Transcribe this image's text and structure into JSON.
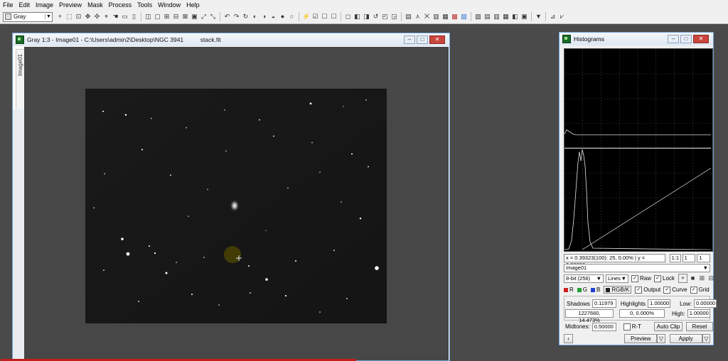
{
  "menu": [
    "File",
    "Edit",
    "Image",
    "Preview",
    "Mask",
    "Process",
    "Tools",
    "Window",
    "Help"
  ],
  "toolbar": {
    "view_mode": "Gray"
  },
  "image_window": {
    "title": "Gray 1:3 - Image01 - C:\\Users\\admin2\\Desktop\\NGC 3941          stack.fit",
    "side_tab": "Image01"
  },
  "histograms": {
    "title": "Histograms",
    "readout": "x = 0.39323(100): 25, 0.00% | y = 0.00000",
    "zoom_ratio": "1:1",
    "zoom_h": "1",
    "zoom_v": "1",
    "view_select": "Image01",
    "resolution": "8-bit (256)",
    "graph_style": "Lines",
    "raw_label": "Raw",
    "lock_label": "Lock",
    "channels": [
      {
        "label": "R",
        "color": "#d02020"
      },
      {
        "label": "G",
        "color": "#20a030"
      },
      {
        "label": "B",
        "color": "#2040d0"
      },
      {
        "label": "RGB/K",
        "color": "#202020"
      }
    ],
    "output_label": "Output",
    "curve_label": "Curve",
    "grid_label": "Grid",
    "shadows_label": "Shadows",
    "shadows_value": "0.11979",
    "shadows_stats": "1227660, 14.473%",
    "highlights_label": "Highlights",
    "highlights_value": "1.00000",
    "highlights_stats": "0, 0.000%",
    "low_label": "Low:",
    "low_value": "0.00000",
    "high_label": "High:",
    "high_value": "1.00000",
    "midtones_label": "Midtones:",
    "midtones_value": "0.50000",
    "rt_label": "R-T",
    "autoclip_label": "Auto Clip",
    "reset_label": "Reset",
    "preview_label": "Preview",
    "apply_label": "Apply"
  }
}
